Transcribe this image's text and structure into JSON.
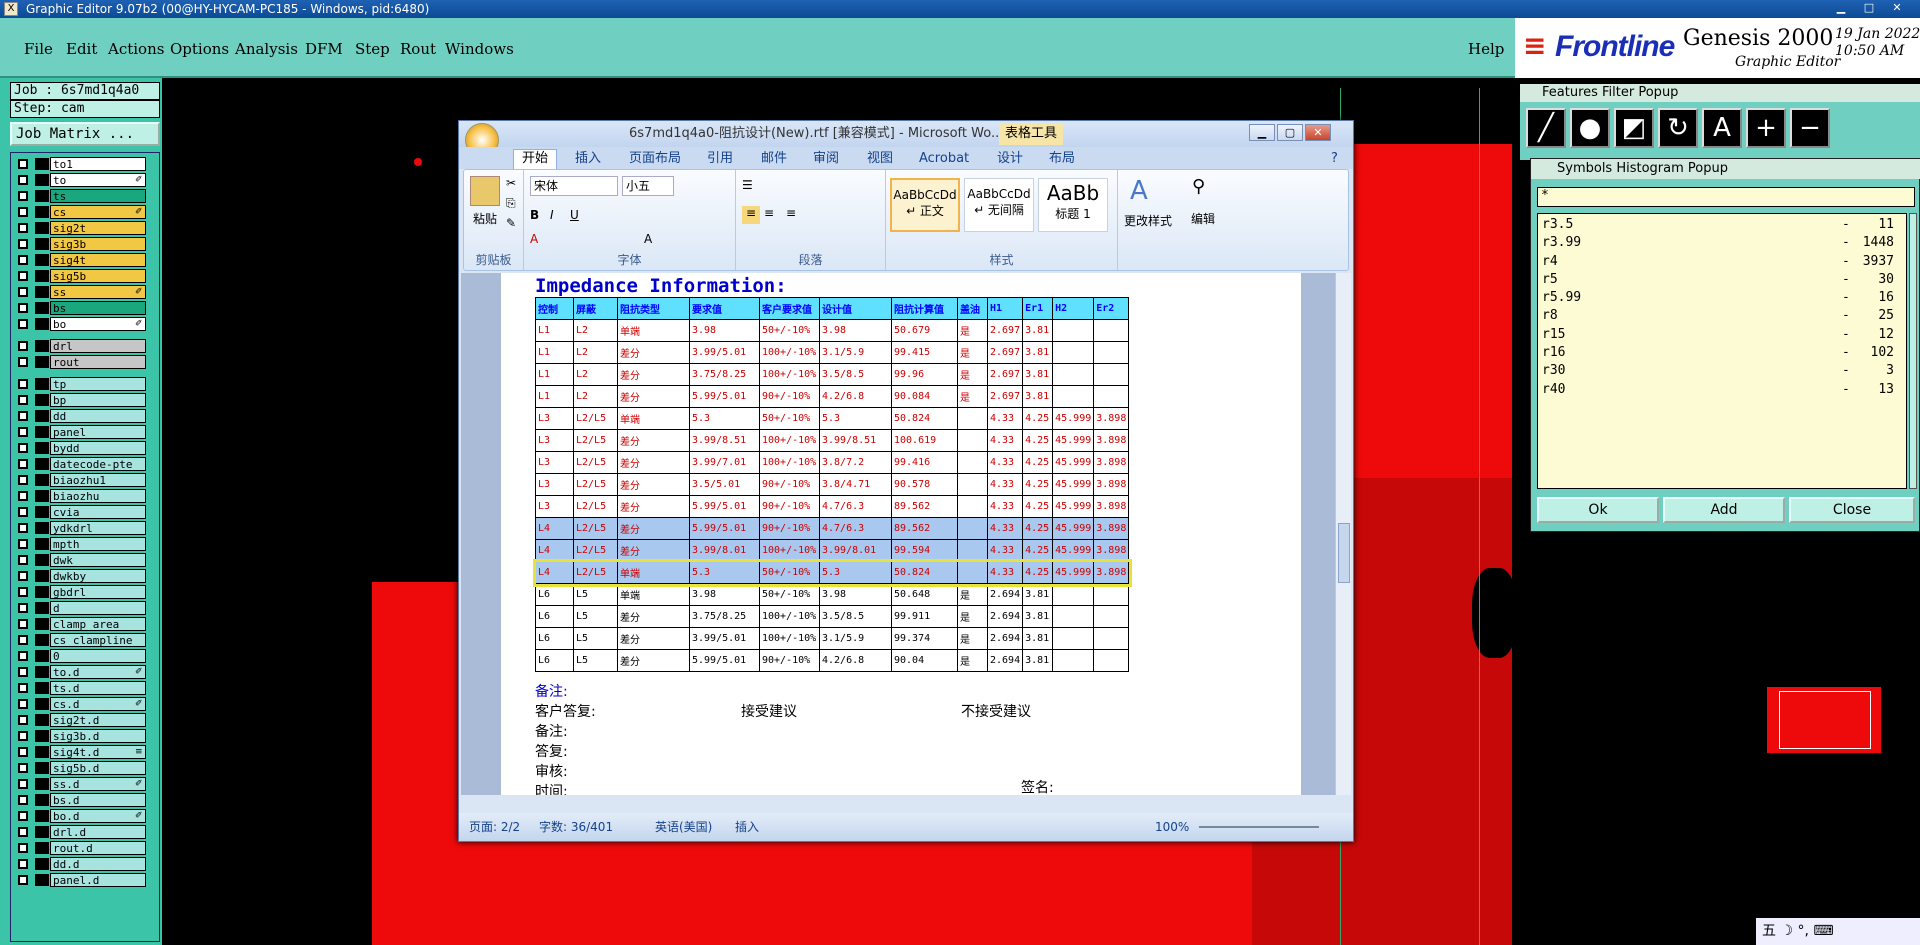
{
  "titlebar": {
    "text": "Graphic Editor 9.07b2 (00@HY-HYCAM-PC185 - Windows, pid:6480)"
  },
  "menubar": {
    "items": [
      "File",
      "Edit",
      "Actions",
      "Options",
      "Analysis",
      "DFM",
      "Step",
      "Rout",
      "Windows"
    ],
    "help": "Help"
  },
  "brand": {
    "logo": "Frontline",
    "product": "Genesis 2000",
    "subtitle": "Graphic Editor",
    "date": "19 Jan 2022",
    "time": "10:50 AM"
  },
  "left": {
    "job": "Job : 6s7md1q4a0",
    "step": "Step: cam",
    "job_matrix": "Job Matrix ..."
  },
  "layers": [
    {
      "name": "to1",
      "color": "#ffffff",
      "flag": ""
    },
    {
      "name": "to",
      "color": "#ffffff",
      "flag": "✐"
    },
    {
      "name": "ts",
      "color": "#1aa77d",
      "flag": ""
    },
    {
      "name": "cs",
      "color": "#f2c744",
      "flag": "✐"
    },
    {
      "name": "sig2t",
      "color": "#f2c744",
      "flag": ""
    },
    {
      "name": "sig3b",
      "color": "#f2c744",
      "flag": ""
    },
    {
      "name": "sig4t",
      "color": "#f2c744",
      "flag": ""
    },
    {
      "name": "sig5b",
      "color": "#f2c744",
      "flag": ""
    },
    {
      "name": "ss",
      "color": "#f2c744",
      "flag": "✐"
    },
    {
      "name": "bs",
      "color": "#1aa77d",
      "flag": ""
    },
    {
      "name": "bo",
      "color": "#ffffff",
      "flag": "✐"
    },
    {
      "name": "drl",
      "color": "#c6c6c6",
      "flag": ""
    },
    {
      "name": "rout",
      "color": "#c6c6c6",
      "flag": ""
    },
    {
      "name": "tp",
      "color": "#a7e4e0",
      "flag": ""
    },
    {
      "name": "bp",
      "color": "#a7e4e0",
      "flag": ""
    },
    {
      "name": "dd",
      "color": "#a7e4e0",
      "flag": ""
    },
    {
      "name": "panel",
      "color": "#a7e4e0",
      "flag": ""
    },
    {
      "name": "bydd",
      "color": "#a7e4e0",
      "flag": ""
    },
    {
      "name": "datecode-pte",
      "color": "#a7e4e0",
      "flag": ""
    },
    {
      "name": "biaozhu1",
      "color": "#a7e4e0",
      "flag": ""
    },
    {
      "name": "biaozhu",
      "color": "#a7e4e0",
      "flag": ""
    },
    {
      "name": "cvia",
      "color": "#a7e4e0",
      "flag": ""
    },
    {
      "name": "ydkdrl",
      "color": "#a7e4e0",
      "flag": ""
    },
    {
      "name": "mpth",
      "color": "#a7e4e0",
      "flag": ""
    },
    {
      "name": "dwk",
      "color": "#a7e4e0",
      "flag": ""
    },
    {
      "name": "dwkby",
      "color": "#a7e4e0",
      "flag": ""
    },
    {
      "name": "gbdrl",
      "color": "#a7e4e0",
      "flag": ""
    },
    {
      "name": "d",
      "color": "#a7e4e0",
      "flag": ""
    },
    {
      "name": "clamp_area",
      "color": "#a7e4e0",
      "flag": ""
    },
    {
      "name": "cs_clampline",
      "color": "#a7e4e0",
      "flag": ""
    },
    {
      "name": "0",
      "color": "#a7e4e0",
      "flag": ""
    },
    {
      "name": "to.d",
      "color": "#a7e4e0",
      "flag": "✐"
    },
    {
      "name": "ts.d",
      "color": "#a7e4e0",
      "flag": ""
    },
    {
      "name": "cs.d",
      "color": "#a7e4e0",
      "flag": "✐"
    },
    {
      "name": "sig2t.d",
      "color": "#a7e4e0",
      "flag": ""
    },
    {
      "name": "sig3b.d",
      "color": "#a7e4e0",
      "flag": ""
    },
    {
      "name": "sig4t.d",
      "color": "#a7e4e0",
      "flag": "≡"
    },
    {
      "name": "sig5b.d",
      "color": "#a7e4e0",
      "flag": ""
    },
    {
      "name": "ss.d",
      "color": "#a7e4e0",
      "flag": "✐"
    },
    {
      "name": "bs.d",
      "color": "#a7e4e0",
      "flag": ""
    },
    {
      "name": "bo.d",
      "color": "#a7e4e0",
      "flag": "✐"
    },
    {
      "name": "drl.d",
      "color": "#a7e4e0",
      "flag": ""
    },
    {
      "name": "rout.d",
      "color": "#a7e4e0",
      "flag": ""
    },
    {
      "name": "dd.d",
      "color": "#a7e4e0",
      "flag": ""
    },
    {
      "name": "panel.d",
      "color": "#a7e4e0",
      "flag": ""
    }
  ],
  "word": {
    "title": "6s7md1q4a0-阻抗设计(New).rtf [兼容模式] - Microsoft Wo...",
    "context_tab": "表格工具",
    "tabs": [
      "开始",
      "插入",
      "页面布局",
      "引用",
      "邮件",
      "审阅",
      "视图",
      "Acrobat",
      "设计",
      "布局"
    ],
    "font_name": "宋体",
    "font_size": "小五",
    "groups": {
      "clipboard": "剪贴板",
      "font": "字体",
      "paragraph": "段落",
      "styles": "样式",
      "edit": "编辑"
    },
    "paste": "粘贴",
    "change_styles": "更改样式",
    "edit_btn": "编辑",
    "styles": [
      {
        "preview": "AaBbCcDd",
        "name": "↵ 正文"
      },
      {
        "preview": "AaBbCcDd",
        "name": "↵ 无间隔"
      },
      {
        "preview": "AaBb",
        "name": "标题 1"
      }
    ],
    "status": {
      "page": "页面: 2/2",
      "words": "字数: 36/401",
      "lang": "英语(美国)",
      "mode": "插入",
      "zoom": "100%"
    }
  },
  "doc": {
    "heading": "Impedance Information:",
    "columns": [
      "控制",
      "屏蔽",
      "阻抗类型",
      "要求值",
      "客户要求值",
      "设计值",
      "阻抗计算值",
      "盖油",
      "H1",
      "Er1",
      "H2",
      "Er2"
    ],
    "rows": [
      [
        "L1",
        "L2",
        "单端",
        "3.98",
        "50+/-10%",
        "3.98",
        "50.679",
        "是",
        "2.697",
        "3.81",
        "",
        ""
      ],
      [
        "L1",
        "L2",
        "差分",
        "3.99/5.01",
        "100+/-10%",
        "3.1/5.9",
        "99.415",
        "是",
        "2.697",
        "3.81",
        "",
        ""
      ],
      [
        "L1",
        "L2",
        "差分",
        "3.75/8.25",
        "100+/-10%",
        "3.5/8.5",
        "99.96",
        "是",
        "2.697",
        "3.81",
        "",
        ""
      ],
      [
        "L1",
        "L2",
        "差分",
        "5.99/5.01",
        "90+/-10%",
        "4.2/6.8",
        "90.084",
        "是",
        "2.697",
        "3.81",
        "",
        ""
      ],
      [
        "L3",
        "L2/L5",
        "单端",
        "5.3",
        "50+/-10%",
        "5.3",
        "50.824",
        "",
        "4.33",
        "4.25",
        "45.999",
        "3.898"
      ],
      [
        "L3",
        "L2/L5",
        "差分",
        "3.99/8.51",
        "100+/-10%",
        "3.99/8.51",
        "100.619",
        "",
        "4.33",
        "4.25",
        "45.999",
        "3.898"
      ],
      [
        "L3",
        "L2/L5",
        "差分",
        "3.99/7.01",
        "100+/-10%",
        "3.8/7.2",
        "99.416",
        "",
        "4.33",
        "4.25",
        "45.999",
        "3.898"
      ],
      [
        "L3",
        "L2/L5",
        "差分",
        "3.5/5.01",
        "90+/-10%",
        "3.8/4.71",
        "90.578",
        "",
        "4.33",
        "4.25",
        "45.999",
        "3.898"
      ],
      [
        "L3",
        "L2/L5",
        "差分",
        "5.99/5.01",
        "90+/-10%",
        "4.7/6.3",
        "89.562",
        "",
        "4.33",
        "4.25",
        "45.999",
        "3.898"
      ],
      [
        "L4",
        "L2/L5",
        "差分",
        "5.99/5.01",
        "90+/-10%",
        "4.7/6.3",
        "89.562",
        "",
        "4.33",
        "4.25",
        "45.999",
        "3.898"
      ],
      [
        "L4",
        "L2/L5",
        "差分",
        "3.99/8.01",
        "100+/-10%",
        "3.99/8.01",
        "99.594",
        "",
        "4.33",
        "4.25",
        "45.999",
        "3.898"
      ],
      [
        "L4",
        "L2/L5",
        "单端",
        "5.3",
        "50+/-10%",
        "5.3",
        "50.824",
        "",
        "4.33",
        "4.25",
        "45.999",
        "3.898"
      ],
      [
        "L6",
        "L5",
        "单端",
        "3.98",
        "50+/-10%",
        "3.98",
        "50.648",
        "是",
        "2.694",
        "3.81",
        "",
        ""
      ],
      [
        "L6",
        "L5",
        "差分",
        "3.75/8.25",
        "100+/-10%",
        "3.5/8.5",
        "99.911",
        "是",
        "2.694",
        "3.81",
        "",
        ""
      ],
      [
        "L6",
        "L5",
        "差分",
        "3.99/5.01",
        "100+/-10%",
        "3.1/5.9",
        "99.374",
        "是",
        "2.694",
        "3.81",
        "",
        ""
      ],
      [
        "L6",
        "L5",
        "差分",
        "5.99/5.01",
        "90+/-10%",
        "4.2/6.8",
        "90.04",
        "是",
        "2.694",
        "3.81",
        "",
        ""
      ]
    ],
    "notes": {
      "remark1": "备注:",
      "reply": "客户答复:",
      "accept": "接受建议",
      "reject": "不接受建议",
      "remark2": "备注:",
      "answer": "答复:",
      "review": "审核:",
      "time": "时间:",
      "sign": "签名:"
    }
  },
  "features_filter": {
    "title": "Features Filter Popup"
  },
  "symbols_histogram": {
    "title": "Symbols Histogram Popup",
    "filter": "*",
    "rows": [
      {
        "sym": "r3.5",
        "count": "11"
      },
      {
        "sym": "r3.99",
        "count": "1448"
      },
      {
        "sym": "r4",
        "count": "3937"
      },
      {
        "sym": "r5",
        "count": "30"
      },
      {
        "sym": "r5.99",
        "count": "16"
      },
      {
        "sym": "r8",
        "count": "25"
      },
      {
        "sym": "r15",
        "count": "12"
      },
      {
        "sym": "r16",
        "count": "102"
      },
      {
        "sym": "r30",
        "count": "3"
      },
      {
        "sym": "r40",
        "count": "13"
      }
    ],
    "ok": "Ok",
    "add": "Add",
    "close": "Close"
  },
  "taskbar": {
    "text": "五 ☽ °, ⌨"
  }
}
